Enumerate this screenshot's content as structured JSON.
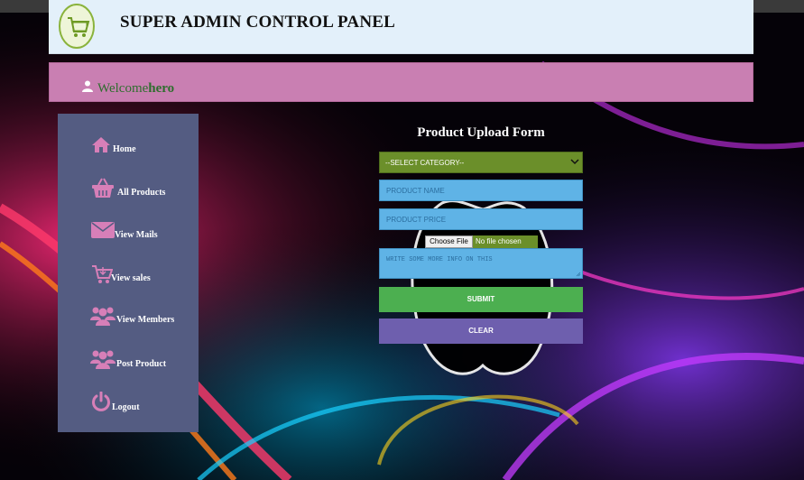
{
  "header": {
    "title": "SUPER ADMIN CONTROL PANEL",
    "logo_icon": "shopping-cart-logo"
  },
  "welcome": {
    "greeting": "Welcome",
    "username": "hero",
    "icon": "user-icon"
  },
  "sidebar": {
    "items": [
      {
        "label": "Home",
        "icon": "home-icon"
      },
      {
        "label": "All Products",
        "icon": "basket-icon"
      },
      {
        "label": "View Mails",
        "icon": "mail-icon"
      },
      {
        "label": "View sales",
        "icon": "cart-icon"
      },
      {
        "label": "View Members",
        "icon": "members-icon"
      },
      {
        "label": "Post Product",
        "icon": "group-icon"
      },
      {
        "label": "Logout",
        "icon": "power-icon"
      }
    ]
  },
  "form": {
    "title": "Product Upload Form",
    "category_select": "--SELECT CATEGORY--",
    "product_name_placeholder": "PRODUCT NAME",
    "product_price_placeholder": "PRODUCT PRICE",
    "file_button": "Choose File",
    "file_status": "No file chosen",
    "info_placeholder": "WRITE SOME MORE INFO ON THIS",
    "submit_label": "SUBMIT",
    "clear_label": "CLEAR"
  },
  "colors": {
    "icon_pink": "#d77fb8",
    "sidebar_bg": "#545c82",
    "welcome_bg": "#c97fb2",
    "input_bg": "#5fb3e6",
    "select_bg": "#6b8f2a",
    "submit_bg": "#4caf50",
    "clear_bg": "#6e5fae"
  }
}
